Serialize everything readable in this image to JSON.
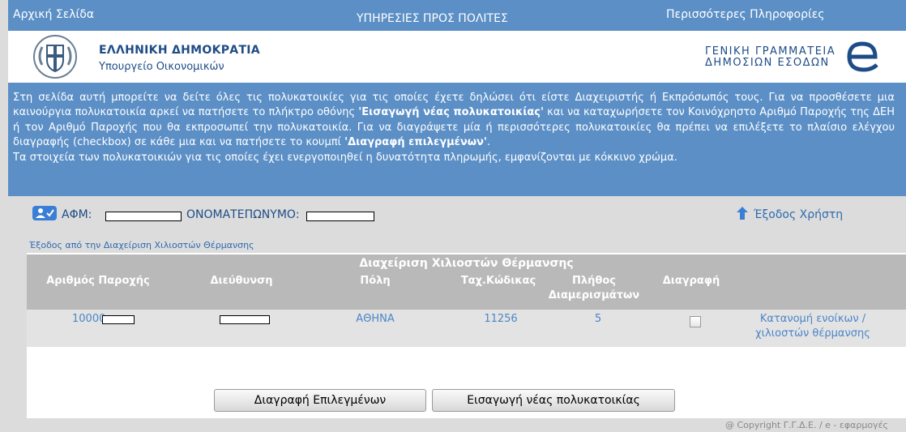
{
  "topbar": {
    "home": "Αρχική Σελίδα",
    "center": "ΥΠΗΡΕΣΙΕΣ ΠΡΟΣ ΠΟΛΙΤΕΣ",
    "more": "Περισσότερες Πληροφορίες"
  },
  "header": {
    "republic": "ΕΛΛΗΝΙΚΗ ΔΗΜΟΚΡΑΤΙΑ",
    "ministry": "Υπουργείο Οικονομικών",
    "gsis_line1": "ΓΕΝΙΚΗ ΓΡΑΜΜΑΤΕΙΑ",
    "gsis_line2": "ΔΗΜΟΣΙΩΝ ΕΣΟΔΩΝ"
  },
  "info": {
    "p1_a": "Στη σελίδα αυτή μπορείτε να δείτε όλες τις πολυκατοικίες για τις οποίες έχετε δηλώσει ότι είστε Διαχειριστής ή Εκπρόσωπός τους. Για να προσθέσετε μια καινούργια πολυκατοικία αρκεί να πατήσετε το πλήκτρο οθόνης ",
    "p1_b": "'Εισαγωγή νέας πολυκατοικίας'",
    "p1_c": " και να καταχωρήσετε τον Κοινόχρηστο Αριθμό Παροχής της ΔΕΗ ή τον Αριθμό Παροχής που θα εκπροσωπεί την πολυκατοικία. Για να διαγράψετε μία ή περισσότερες πολυκατοικίες θα πρέπει να επιλέξετε το πλαίσιο ελέγχου διαγραφής (checkbox) σε κάθε μια και να πατήσετε το κουμπί ",
    "p1_d": "'Διαγραφή επιλεγμένων'",
    "p1_e": ".",
    "p2": "Τα στοιχεία των πολυκατοικιών για τις οποίες έχει ενεργοποιηθεί η δυνατότητα πληρωμής, εμφανίζονται με κόκκινο χρώμα."
  },
  "user": {
    "afm_label": "ΑΦΜ:",
    "name_label": "ΟΝΟΜΑΤΕΠΩΝΥΜΟ:",
    "exit": "Έξοδος Χρήστη"
  },
  "heating": {
    "exit_link": "Έξοδος από την Διαχείριση Χιλιοστών Θέρμανσης",
    "title": "Διαχείριση Χιλιοστών Θέρμανσης",
    "headers": {
      "supply": "Αριθμός Παροχής",
      "address": "Διεύθυνση",
      "city": "Πόλη",
      "zip": "Ταχ.Κώδικας",
      "apts_1": "Πλήθος",
      "apts_2": "Διαμερισμάτων",
      "delete": "Διαγραφή"
    },
    "row": {
      "supply_prefix": "10000",
      "city": "ΑΘΗΝΑ",
      "zip": "11256",
      "apts": "5",
      "link_1": "Κατανομή ενοίκων /",
      "link_2": "χιλιοστών θέρμανσης"
    }
  },
  "buttons": {
    "delete_selected": "Διαγραφή Επιλεγμένων",
    "add_new": "Εισαγωγή νέας πολυκατοικίας"
  },
  "footer": {
    "copyright": "@ Copyright Γ.Γ.Δ.Ε. / e - εφαρμογές"
  },
  "colors": {
    "blue": "#5b8fc6",
    "header_text": "#1e4c86",
    "link": "#4a86c8"
  }
}
